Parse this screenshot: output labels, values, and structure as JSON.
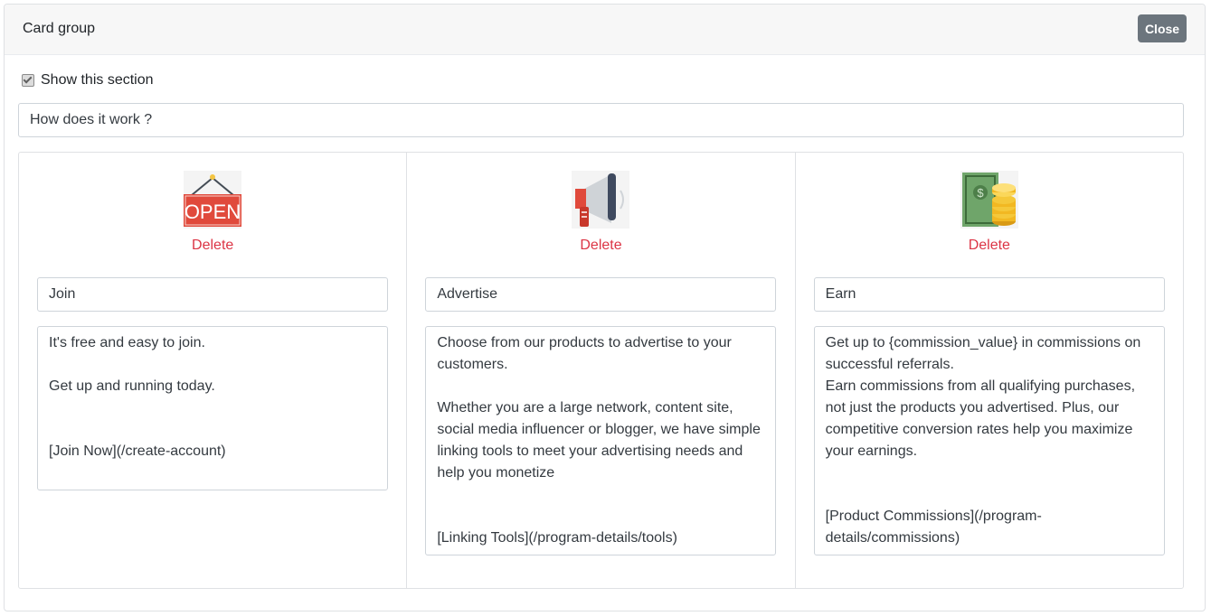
{
  "header": {
    "title": "Card group",
    "close_label": "Close"
  },
  "show_section": {
    "label": "Show this section",
    "checked": true
  },
  "section_title": {
    "value": "How does it work ?"
  },
  "cards": [
    {
      "icon": "open-sign-icon",
      "delete_label": "Delete",
      "title": "Join",
      "text": "It's free and easy to join.\n\nGet up and running today.\n\n\n[Join Now](/create-account)"
    },
    {
      "icon": "megaphone-icon",
      "delete_label": "Delete",
      "title": "Advertise",
      "text": "Choose from our products to advertise to your customers.\n\nWhether you are a large network, content site, social media influencer or blogger, we have simple linking tools to meet your advertising needs and help you monetize\n\n\n[Linking Tools](/program-details/tools)"
    },
    {
      "icon": "money-coins-icon",
      "delete_label": "Delete",
      "title": "Earn",
      "text": "Get up to {commission_value} in commissions on successful referrals.\nEarn commissions from all qualifying purchases, not just the products you advertised. Plus, our competitive conversion rates help you maximize your earnings.\n\n\n[Product Commissions](/program-details/commissions)"
    }
  ],
  "colors": {
    "delete": "#dc3545",
    "close_button": "#6c757d",
    "header_bg": "#f7f7f7"
  }
}
